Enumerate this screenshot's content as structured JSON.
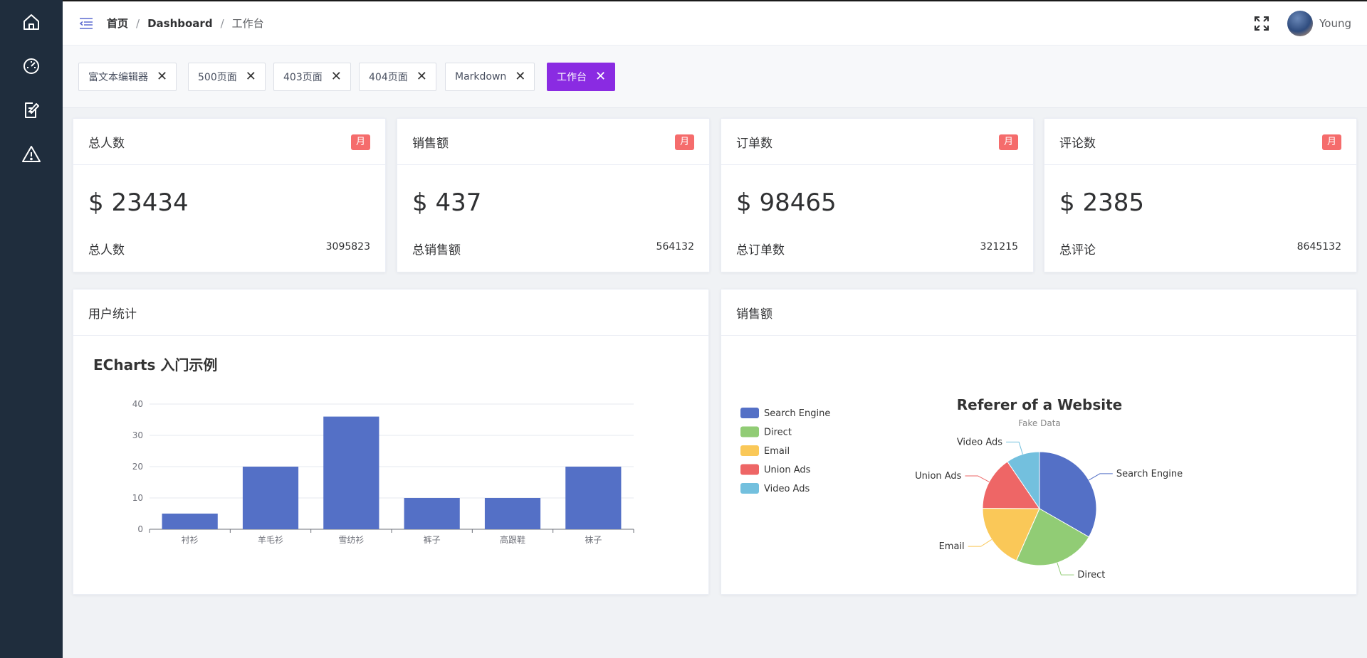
{
  "sidebar": {
    "items": [
      {
        "icon": "home-icon"
      },
      {
        "icon": "dashboard-gauge-icon"
      },
      {
        "icon": "edit-document-icon"
      },
      {
        "icon": "warning-icon"
      }
    ]
  },
  "header": {
    "breadcrumb": [
      "首页",
      "Dashboard",
      "工作台"
    ],
    "username": "Young"
  },
  "tags": [
    {
      "label": "富文本编辑器",
      "active": false
    },
    {
      "label": "500页面",
      "active": false
    },
    {
      "label": "403页面",
      "active": false
    },
    {
      "label": "404页面",
      "active": false
    },
    {
      "label": "Markdown",
      "active": false
    },
    {
      "label": "工作台",
      "active": true
    }
  ],
  "stats": [
    {
      "title": "总人数",
      "badge": "月",
      "value": "$ 23434",
      "foot_label": "总人数",
      "foot_value": "3095823"
    },
    {
      "title": "销售额",
      "badge": "月",
      "value": "$ 437",
      "foot_label": "总销售额",
      "foot_value": "564132"
    },
    {
      "title": "订单数",
      "badge": "月",
      "value": "$ 98465",
      "foot_label": "总订单数",
      "foot_value": "321215"
    },
    {
      "title": "评论数",
      "badge": "月",
      "value": "$ 2385",
      "foot_label": "总评论",
      "foot_value": "8645132"
    }
  ],
  "panels": {
    "user_stats": {
      "title": "用户统计"
    },
    "sales": {
      "title": "销售额"
    }
  },
  "colors": {
    "accent": "#8a2be2",
    "badge": "#f56c6c",
    "sidebar": "#1f2d3d",
    "bar": "#5470c6"
  },
  "chart_data": [
    {
      "type": "bar",
      "title": "ECharts 入门示例",
      "categories": [
        "衬衫",
        "羊毛衫",
        "雪纺衫",
        "裤子",
        "高跟鞋",
        "袜子"
      ],
      "values": [
        5,
        20,
        36,
        10,
        10,
        20
      ],
      "ylim": [
        0,
        40
      ],
      "yticks": [
        0,
        10,
        20,
        30,
        40
      ],
      "grid": true
    },
    {
      "type": "pie",
      "title": "Referer of a Website",
      "subtitle": "Fake Data",
      "legend_position": "top-left",
      "slices": [
        {
          "name": "Search Engine",
          "value": 1048,
          "color": "#5470c6"
        },
        {
          "name": "Direct",
          "value": 735,
          "color": "#91cc75"
        },
        {
          "name": "Email",
          "value": 580,
          "color": "#fac858"
        },
        {
          "name": "Union Ads",
          "value": 484,
          "color": "#ee6666"
        },
        {
          "name": "Video Ads",
          "value": 300,
          "color": "#73c0de"
        }
      ]
    }
  ]
}
